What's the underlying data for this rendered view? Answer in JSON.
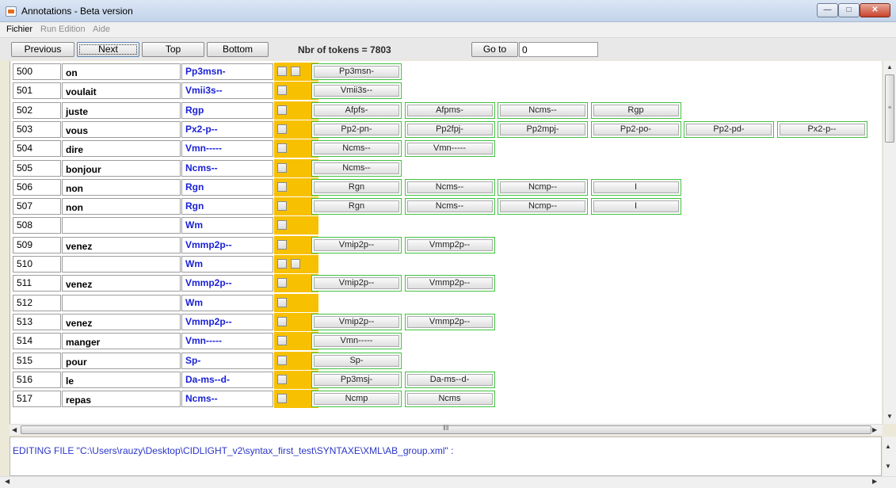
{
  "window": {
    "title": "Annotations - Beta version"
  },
  "menu": {
    "fichier": "Fichier",
    "run": "Run",
    "edition": "Edition",
    "aide": "Aide"
  },
  "toolbar": {
    "previous": "Previous",
    "next": "Next",
    "top": "Top",
    "bottom": "Bottom",
    "tokens_label": "Nbr of tokens = 7803",
    "goto": "Go to",
    "goto_value": "0"
  },
  "rows": [
    {
      "num": "500",
      "word": "on",
      "tag": "Pp3msn-",
      "checks": 2,
      "options": [
        "Pp3msn-"
      ]
    },
    {
      "num": "501",
      "word": "voulait",
      "tag": "Vmii3s--",
      "checks": 1,
      "options": [
        "Vmii3s--"
      ]
    },
    {
      "num": "502",
      "word": "juste",
      "tag": "Rgp",
      "checks": 1,
      "options": [
        "Afpfs-",
        "Afpms-",
        "Ncms--",
        "Rgp"
      ]
    },
    {
      "num": "503",
      "word": "vous",
      "tag": "Px2-p--",
      "checks": 1,
      "options": [
        "Pp2-pn-",
        "Pp2fpj-",
        "Pp2mpj-",
        "Pp2-po-",
        "Pp2-pd-",
        "Px2-p--"
      ]
    },
    {
      "num": "504",
      "word": "dire",
      "tag": "Vmn-----",
      "checks": 1,
      "options": [
        "Ncms--",
        "Vmn-----"
      ]
    },
    {
      "num": "505",
      "word": "bonjour",
      "tag": "Ncms--",
      "checks": 1,
      "options": [
        "Ncms--"
      ]
    },
    {
      "num": "506",
      "word": "non",
      "tag": "Rgn",
      "checks": 1,
      "options": [
        "Rgn",
        "Ncms--",
        "Ncmp--",
        "I"
      ]
    },
    {
      "num": "507",
      "word": "non",
      "tag": "Rgn",
      "checks": 1,
      "options": [
        "Rgn",
        "Ncms--",
        "Ncmp--",
        "I"
      ]
    },
    {
      "num": "508",
      "word": "",
      "tag": "Wm",
      "checks": 1,
      "options": []
    },
    {
      "num": "509",
      "word": "venez",
      "tag": "Vmmp2p--",
      "checks": 1,
      "options": [
        "Vmip2p--",
        "Vmmp2p--"
      ]
    },
    {
      "num": "510",
      "word": "",
      "tag": "Wm",
      "checks": 2,
      "options": []
    },
    {
      "num": "511",
      "word": "venez",
      "tag": "Vmmp2p--",
      "checks": 1,
      "options": [
        "Vmip2p--",
        "Vmmp2p--"
      ]
    },
    {
      "num": "512",
      "word": "",
      "tag": "Wm",
      "checks": 1,
      "options": []
    },
    {
      "num": "513",
      "word": "venez",
      "tag": "Vmmp2p--",
      "checks": 1,
      "options": [
        "Vmip2p--",
        "Vmmp2p--"
      ]
    },
    {
      "num": "514",
      "word": "manger",
      "tag": "Vmn-----",
      "checks": 1,
      "options": [
        "Vmn-----"
      ]
    },
    {
      "num": "515",
      "word": "pour",
      "tag": "Sp-",
      "checks": 1,
      "options": [
        "Sp-"
      ]
    },
    {
      "num": "516",
      "word": "le",
      "tag": "Da-ms--d-",
      "checks": 1,
      "options": [
        "Pp3msj-",
        "Da-ms--d-"
      ]
    },
    {
      "num": "517",
      "word": "repas",
      "tag": "Ncms--",
      "checks": 1,
      "options": [
        "Ncmp",
        "Ncms"
      ]
    }
  ],
  "console": {
    "text": "EDITING FILE \"C:\\Users\\rauzy\\Desktop\\CIDLIGHT_v2\\syntax_first_test\\SYNTAXE\\XML\\AB_group.xml\" :"
  },
  "colors": {
    "checkbox_column": "#f7c000",
    "tag_text": "#1a21d6",
    "option_border": "#41c241",
    "console_text": "#2a35c8"
  }
}
